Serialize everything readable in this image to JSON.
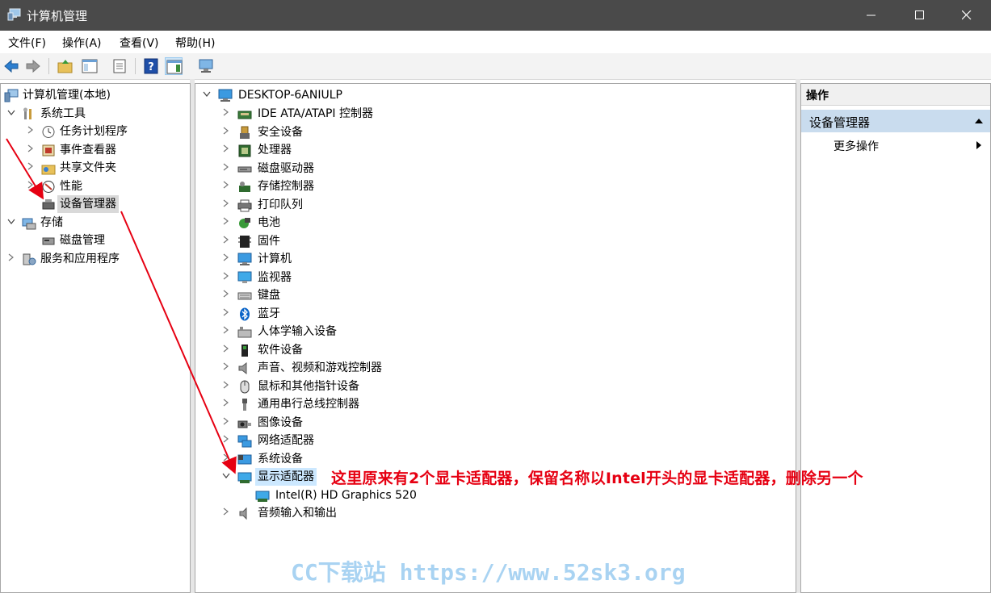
{
  "window": {
    "title": "计算机管理"
  },
  "menu": [
    "文件(F)",
    "操作(A)",
    "查看(V)",
    "帮助(H)"
  ],
  "left_tree": [
    {
      "label": "计算机管理(本地)",
      "icon": "computer-management-icon",
      "chev": ""
    },
    {
      "label": "系统工具",
      "icon": "tools-icon",
      "chev": "v"
    },
    {
      "label": "任务计划程序",
      "icon": "clock-icon",
      "chev": ">"
    },
    {
      "label": "事件查看器",
      "icon": "event-viewer-icon",
      "chev": ">"
    },
    {
      "label": "共享文件夹",
      "icon": "shared-folder-icon",
      "chev": ">"
    },
    {
      "label": "性能",
      "icon": "performance-icon",
      "chev": ">"
    },
    {
      "label": "设备管理器",
      "icon": "device-manager-icon",
      "chev": ""
    },
    {
      "label": "存储",
      "icon": "storage-icon",
      "chev": "v"
    },
    {
      "label": "磁盘管理",
      "icon": "disk-management-icon",
      "chev": ""
    },
    {
      "label": "服务和应用程序",
      "icon": "services-icon",
      "chev": ">"
    }
  ],
  "device_tree": {
    "root": "DESKTOP-6ANIULP",
    "categories": [
      {
        "label": "IDE ATA/ATAPI 控制器",
        "icon": "ide-controller-icon"
      },
      {
        "label": "安全设备",
        "icon": "security-device-icon"
      },
      {
        "label": "处理器",
        "icon": "processor-icon"
      },
      {
        "label": "磁盘驱动器",
        "icon": "disk-drive-icon"
      },
      {
        "label": "存储控制器",
        "icon": "storage-controller-icon"
      },
      {
        "label": "打印队列",
        "icon": "printer-icon"
      },
      {
        "label": "电池",
        "icon": "battery-icon"
      },
      {
        "label": "固件",
        "icon": "firmware-icon"
      },
      {
        "label": "计算机",
        "icon": "computer-icon"
      },
      {
        "label": "监视器",
        "icon": "monitor-icon"
      },
      {
        "label": "键盘",
        "icon": "keyboard-icon"
      },
      {
        "label": "蓝牙",
        "icon": "bluetooth-icon"
      },
      {
        "label": "人体学输入设备",
        "icon": "hid-icon"
      },
      {
        "label": "软件设备",
        "icon": "software-device-icon"
      },
      {
        "label": "声音、视频和游戏控制器",
        "icon": "sound-icon"
      },
      {
        "label": "鼠标和其他指针设备",
        "icon": "mouse-icon"
      },
      {
        "label": "通用串行总线控制器",
        "icon": "usb-icon"
      },
      {
        "label": "图像设备",
        "icon": "camera-icon"
      },
      {
        "label": "网络适配器",
        "icon": "network-adapter-icon"
      },
      {
        "label": "系统设备",
        "icon": "system-device-icon"
      },
      {
        "label": "显示适配器",
        "icon": "display-adapter-icon"
      },
      {
        "label": "Intel(R) HD Graphics 520",
        "icon": "display-adapter-icon",
        "child": true
      },
      {
        "label": "音频输入和输出",
        "icon": "audio-io-icon"
      }
    ]
  },
  "actions": {
    "header": "操作",
    "section": "设备管理器",
    "more": "更多操作"
  },
  "annotation": "这里原来有2个显卡适配器，保留名称以Intel开头的显卡适配器，删除另一个",
  "watermark": "CC下载站 https://www.52sk3.org",
  "colors": {
    "annotation": "#e60012",
    "titlebar": "#4a4a4a",
    "selection": "#cce8ff"
  }
}
